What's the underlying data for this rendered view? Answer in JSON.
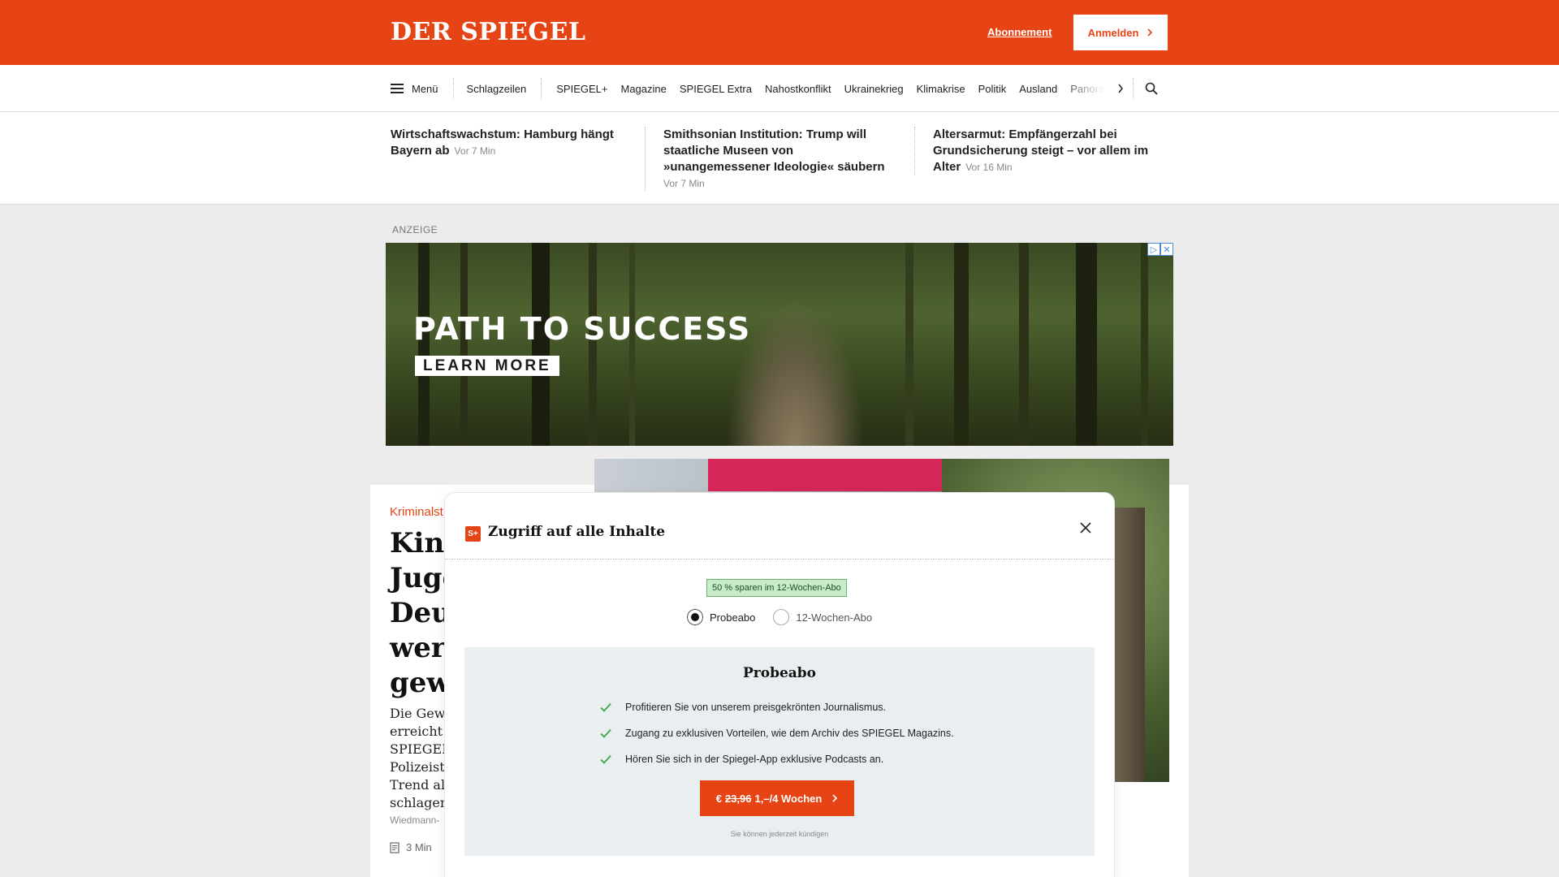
{
  "header": {
    "logo": "DER SPIEGEL",
    "subscription_link": "Abonnement",
    "login_button": "Anmelden"
  },
  "nav": {
    "menu_label": "Menü",
    "items": [
      "Schlagzeilen",
      "SPIEGEL+",
      "Magazine",
      "SPIEGEL Extra",
      "Nahostkonflikt",
      "Ukrainekrieg",
      "Klimakrise",
      "Politik",
      "Ausland",
      "Panorama"
    ]
  },
  "headlines": [
    {
      "title": "Wirtschaftswachstum: Hamburg hängt Bayern ab",
      "time": "Vor 7 Min"
    },
    {
      "title": "Smithsonian Institution: Trump will staatliche Museen von »unangemessener Ideologie« säubern",
      "time": "Vor 7 Min"
    },
    {
      "title": "Altersarmut: Empfängerzahl bei Grundsicherung steigt – vor allem im Alter",
      "time": "Vor 16 Min"
    }
  ],
  "ad": {
    "label": "ANZEIGE",
    "title": "PATH TO SUCCESS",
    "cta": "LEARN MORE"
  },
  "article": {
    "kicker": "Kriminalst",
    "title_lines": [
      "Kind",
      "Jugen",
      "Deuts",
      "werd",
      "gewa"
    ],
    "teaser_lines": [
      "Die Gewa",
      "erreicht ei",
      "SPIEGEL",
      "Polizeista",
      "Trend alar",
      "schlagen N"
    ],
    "author": "Wiedmann-",
    "read_time": "3 Min"
  },
  "modal": {
    "badge_icon": "S+",
    "title": "Zugriff auf alle Inhalte",
    "save_badge": "50 % sparen im 12-Wochen-Abo",
    "options": [
      {
        "label": "Probeabo",
        "selected": true
      },
      {
        "label": "12-Wochen-Abo",
        "selected": false
      }
    ],
    "offer_title": "Probeabo",
    "benefits": [
      "Profitieren Sie von unserem preisgekrönten Journalismus.",
      "Zugang zu exklusiven Vorteilen, wie dem Archiv des SPIEGEL Magazins.",
      "Hören Sie sich in der Spiegel-App exklusive Podcasts an."
    ],
    "cta": {
      "currency": "€",
      "old_price": "23,96",
      "new_price": "1,–/4 Wochen"
    },
    "cancel_note": "Sie können jederzeit kündigen"
  },
  "colors": {
    "brand": "#e64415",
    "check": "#3aa84a",
    "offer_bg": "#e9eef1"
  }
}
